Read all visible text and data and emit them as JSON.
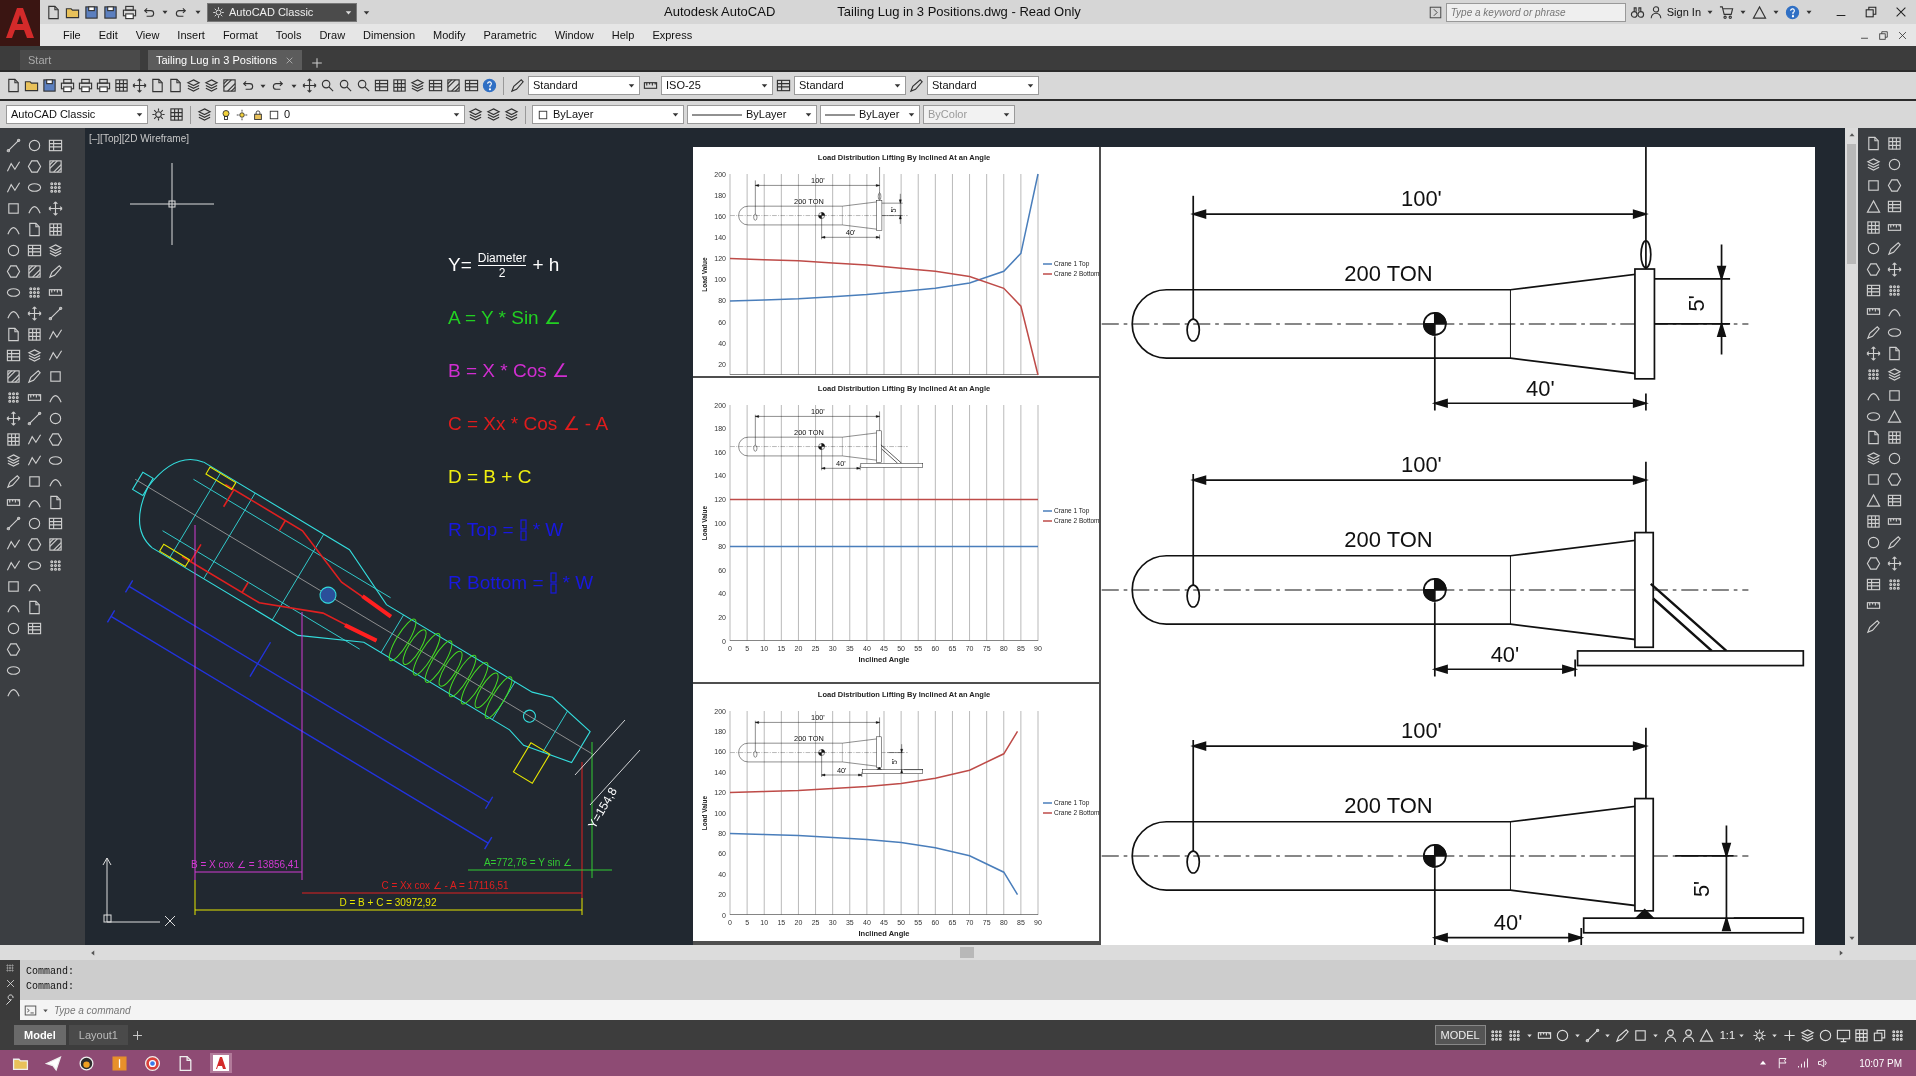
{
  "title_bar": {
    "workspace": "AutoCAD Classic",
    "app": "Autodesk AutoCAD",
    "document": "Tailing Lug in 3 Positions.dwg - Read Only",
    "search": {
      "placeholder": "Type a keyword or phrase"
    },
    "sign_in": "Sign In"
  },
  "menu": [
    "File",
    "Edit",
    "View",
    "Insert",
    "Format",
    "Tools",
    "Draw",
    "Dimension",
    "Modify",
    "Parametric",
    "Window",
    "Help",
    "Express"
  ],
  "file_tabs": [
    {
      "label": "Start",
      "selected": false,
      "closable": false
    },
    {
      "label": "Tailing Lug in 3 Positions",
      "selected": true,
      "closable": true
    }
  ],
  "toolbar_dropdowns": [
    "Standard",
    "ISO-25",
    "Standard",
    "Standard"
  ],
  "properties_bar": {
    "workspace": "AutoCAD Classic",
    "layer": "0",
    "color_setting": "ByLayer",
    "linetype": "ByLayer",
    "lineweight": "ByLayer",
    "plot_style": {
      "value": "ByColor",
      "disabled": true
    }
  },
  "viewport_label": "[–][Top][2D Wireframe]",
  "formulas": [
    {
      "kind": "fraction",
      "lead": "Y=",
      "numerator": "Diameter",
      "denominator": "2",
      "tail": "+ h",
      "color": "#ffffff"
    },
    {
      "kind": "plain",
      "text": "A = Y * Sin ∠",
      "color": "#22d022"
    },
    {
      "kind": "plain",
      "text": "B = X * Cos ∠",
      "color": "#d02ed0"
    },
    {
      "kind": "plain",
      "text": "C = Xx * Cos ∠  -  A",
      "color": "#e01c1c"
    },
    {
      "kind": "plain",
      "text": "D = B + C",
      "color": "#eeee10"
    },
    {
      "kind": "ratio",
      "lead": "R Top =",
      "tail": "* W",
      "color": "#1818e0"
    },
    {
      "kind": "ratio",
      "lead": "R Bottom =",
      "tail": "* W",
      "color": "#1818e0"
    }
  ],
  "cad_dimensions": [
    {
      "text": "Y=154,8",
      "color": "#ffffff"
    },
    {
      "text": "B = X cox ∠ = 13856,41",
      "color": "#d23ad2"
    },
    {
      "text": "A=772,76 = Y sin ∠",
      "color": "#33cc33"
    },
    {
      "text": "C = Xx cox ∠ - A = 17116,51",
      "color": "#e02020"
    },
    {
      "text": "D = B + C = 30972,92",
      "color": "#e6e600"
    }
  ],
  "charts": [
    {
      "inset": {
        "kind": "hanging",
        "span": "100'",
        "weight": "200 TON",
        "offset": "40'",
        "lift": "5'"
      },
      "chart_data": {
        "type": "line",
        "title": "Load Distribution Lifting By Inclined At an Angle",
        "ylabel": "Load Value",
        "x": [
          0,
          10,
          20,
          30,
          40,
          50,
          60,
          70,
          80,
          85,
          90
        ],
        "series": [
          {
            "name": "Crane 1 Top",
            "color": "#4a7ebb",
            "values": [
              80,
              81,
              82,
              84,
              86,
              89,
              92,
              97,
              108,
              125,
              200
            ]
          },
          {
            "name": "Crane 2 Bottom",
            "color": "#be4b48",
            "values": [
              120,
              119,
              118,
              116,
              114,
              111,
              108,
              103,
              92,
              75,
              10
            ]
          }
        ],
        "xlim": [
          0,
          90
        ],
        "ylim": [
          10,
          200
        ],
        "yticks": [
          20,
          40,
          60,
          80,
          100,
          120,
          140,
          160,
          180,
          200
        ],
        "grid": true,
        "legend": true
      }
    },
    {
      "inset": {
        "kind": "stand",
        "span": "100'",
        "weight": "200 TON",
        "offset": "40'"
      },
      "chart_data": {
        "type": "line",
        "title": "Load Distribution Lifting By Inclined At an Angle",
        "xlabel": "Inclined Angle",
        "ylabel": "Load Value",
        "x": [
          0,
          90
        ],
        "series": [
          {
            "name": "Crane 1 Top",
            "color": "#4a7ebb",
            "values": [
              80,
              80
            ]
          },
          {
            "name": "Crane 2 Bottom",
            "color": "#be4b48",
            "values": [
              120,
              120
            ]
          }
        ],
        "xlim": [
          0,
          90
        ],
        "ylim": [
          0,
          200
        ],
        "xticks": [
          0,
          5,
          10,
          15,
          20,
          25,
          30,
          35,
          40,
          45,
          50,
          55,
          60,
          65,
          70,
          75,
          80,
          85,
          90
        ],
        "yticks": [
          0,
          20,
          40,
          60,
          80,
          100,
          120,
          140,
          160,
          180,
          200
        ],
        "grid": true,
        "legend": true
      }
    },
    {
      "inset": {
        "kind": "ground",
        "span": "100'",
        "weight": "200 TON",
        "offset": "40'",
        "lift": "5'"
      },
      "chart_data": {
        "type": "line",
        "title": "Load Distribution Lifting By Inclined At an Angle",
        "xlabel": "Inclined Angle",
        "ylabel": "Load Value",
        "x": [
          0,
          10,
          20,
          30,
          40,
          50,
          60,
          70,
          80,
          84
        ],
        "series": [
          {
            "name": "Crane 1 Top",
            "color": "#4a7ebb",
            "values": [
              80,
              79,
              78,
              76,
              74,
              71,
              66,
              58,
              42,
              20
            ]
          },
          {
            "name": "Crane 2 Bottom",
            "color": "#be4b48",
            "values": [
              120,
              121,
              122,
              124,
              126,
              129,
              134,
              142,
              158,
              180
            ]
          }
        ],
        "xlim": [
          0,
          90
        ],
        "ylim": [
          0,
          200
        ],
        "xticks": [
          0,
          5,
          10,
          15,
          20,
          25,
          30,
          35,
          40,
          45,
          50,
          55,
          60,
          65,
          70,
          75,
          80,
          85,
          90
        ],
        "yticks": [
          0,
          20,
          40,
          60,
          80,
          100,
          120,
          140,
          160,
          180,
          200
        ],
        "grid": true,
        "legend": true
      }
    }
  ],
  "diagrams": [
    {
      "kind": "hanging",
      "span": "100'",
      "weight": "200 TON",
      "offset": "40'",
      "lift": "5'"
    },
    {
      "kind": "stand",
      "span": "100'",
      "weight": "200 TON",
      "offset": "40'"
    },
    {
      "kind": "ground",
      "span": "100'",
      "weight": "200 TON",
      "offset": "40'",
      "lift": "5'"
    }
  ],
  "command_history": [
    "Command:",
    "Command:"
  ],
  "command_input": {
    "placeholder": "Type a command"
  },
  "layout_tabs": [
    {
      "label": "Model",
      "selected": true
    },
    {
      "label": "Layout1",
      "selected": false
    }
  ],
  "status_bar": {
    "space": "MODEL",
    "scale": "1:1"
  },
  "taskbar": {
    "clock": "10:07 PM"
  }
}
